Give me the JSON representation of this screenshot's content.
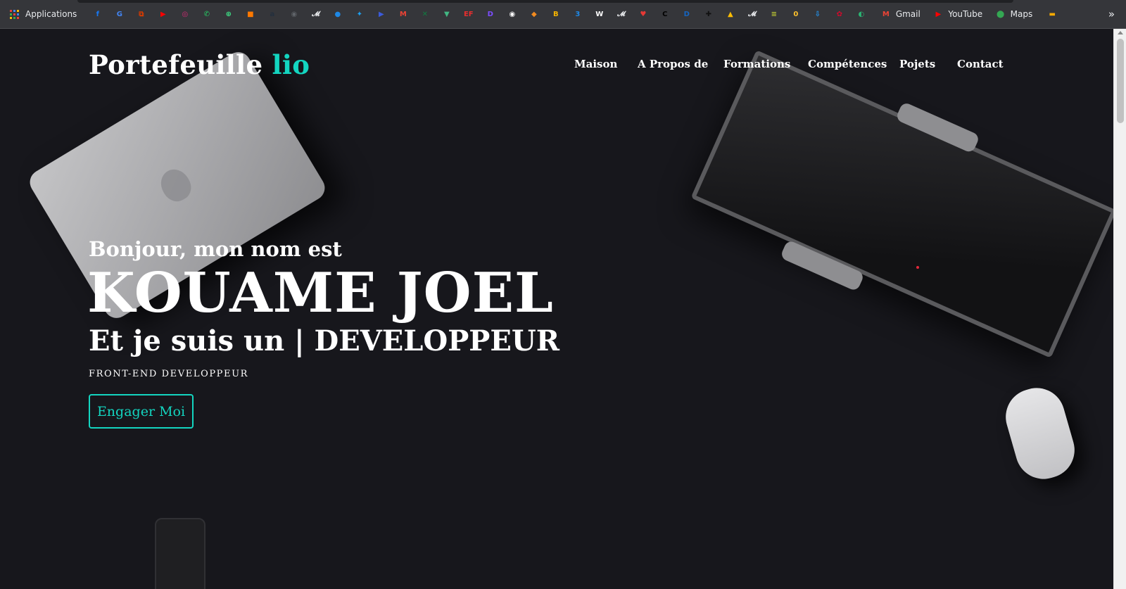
{
  "bookmarks": {
    "apps_label": "Applications",
    "icons": [
      {
        "name": "facebook-icon",
        "glyph": "f",
        "color": "#1877f2"
      },
      {
        "name": "google-translate-icon",
        "glyph": "G",
        "color": "#4285f4"
      },
      {
        "name": "office-icon",
        "glyph": "⧉",
        "color": "#d83b01"
      },
      {
        "name": "youtube-icon",
        "glyph": "▶",
        "color": "#ff0000"
      },
      {
        "name": "instagram-icon",
        "glyph": "◎",
        "color": "#d62976"
      },
      {
        "name": "whatsapp-icon",
        "glyph": "✆",
        "color": "#25d366"
      },
      {
        "name": "android-icon",
        "glyph": "⊕",
        "color": "#3ddc84"
      },
      {
        "name": "orange-icon",
        "glyph": "■",
        "color": "#ff7900"
      },
      {
        "name": "amazon-icon",
        "glyph": "a",
        "color": "#232f3e"
      },
      {
        "name": "globe-icon",
        "glyph": "◉",
        "color": "#5f6368"
      },
      {
        "name": "script-icon",
        "glyph": "𝓜",
        "color": "#e8eaed"
      },
      {
        "name": "cloud-icon",
        "glyph": "●",
        "color": "#1e88e5"
      },
      {
        "name": "twitter-icon",
        "glyph": "✦",
        "color": "#1da1f2"
      },
      {
        "name": "video-icon",
        "glyph": "▶",
        "color": "#3b5bdb"
      },
      {
        "name": "gmail-icon",
        "glyph": "M",
        "color": "#ea4335"
      },
      {
        "name": "excel-icon",
        "glyph": "✕",
        "color": "#107c41"
      },
      {
        "name": "vue-icon",
        "glyph": "▼",
        "color": "#42b883"
      },
      {
        "name": "ef-icon",
        "glyph": "EF",
        "color": "#e62e2e"
      },
      {
        "name": "d-app-icon",
        "glyph": "D",
        "color": "#7c4dff"
      },
      {
        "name": "record-icon",
        "glyph": "◉",
        "color": "#ffffff"
      },
      {
        "name": "diamond-icon",
        "glyph": "◆",
        "color": "#f28b20"
      },
      {
        "name": "b-app-icon",
        "glyph": "B",
        "color": "#f5b400"
      },
      {
        "name": "3d-icon",
        "glyph": "3",
        "color": "#1e88e5"
      },
      {
        "name": "w-app-icon",
        "glyph": "W",
        "color": "#ffffff"
      },
      {
        "name": "script2-icon",
        "glyph": "𝓜",
        "color": "#e8eaed"
      },
      {
        "name": "heart-icon",
        "glyph": "♥",
        "color": "#e53935"
      },
      {
        "name": "c-app-icon",
        "glyph": "C",
        "color": "#000000"
      },
      {
        "name": "dp-icon",
        "glyph": "D",
        "color": "#1565c0"
      },
      {
        "name": "plus-icon",
        "glyph": "✚",
        "color": "#111111"
      },
      {
        "name": "google-drive-icon",
        "glyph": "▲",
        "color": "#fbbc04"
      },
      {
        "name": "script3-icon",
        "glyph": "𝓜",
        "color": "#e8eaed"
      },
      {
        "name": "layers-icon",
        "glyph": "≡",
        "color": "#c0ca33"
      },
      {
        "name": "coin-icon",
        "glyph": "0",
        "color": "#fbc02d"
      },
      {
        "name": "download-icon",
        "glyph": "⇩",
        "color": "#2196f3"
      },
      {
        "name": "huawei-icon",
        "glyph": "✿",
        "color": "#cf0a2c"
      },
      {
        "name": "edge-icon",
        "glyph": "◐",
        "color": "#2ab673"
      }
    ],
    "labeled": [
      {
        "name": "bookmark-gmail",
        "icon_name": "gmail-logo-icon",
        "glyph": "M",
        "color": "#ea4335",
        "label": "Gmail"
      },
      {
        "name": "bookmark-youtube",
        "icon_name": "youtube-logo-icon",
        "glyph": "▶",
        "color": "#ff0000",
        "label": "YouTube"
      },
      {
        "name": "bookmark-maps",
        "icon_name": "maps-pin-icon",
        "glyph": "⬤",
        "color": "#34a853",
        "label": "Maps"
      }
    ],
    "extra_icon": {
      "name": "folder-icon",
      "glyph": "▬",
      "color": "#f9ab00"
    },
    "more": "»"
  },
  "header": {
    "logo_main": "Portefeuille",
    "logo_accent": "lio",
    "nav": [
      "Maison",
      "A Propos de",
      "Formations",
      "Compétences",
      "Pojets",
      "Contact"
    ]
  },
  "hero": {
    "greeting": "Bonjour, mon nom est",
    "name": "KOUAME JOEL",
    "role": "Et je suis un | DEVELOPPEUR",
    "subtitle": "FRONT-END DEVELOPPEUR",
    "cta": "Engager Moi"
  },
  "colors": {
    "accent": "#13d5c0",
    "background": "#17171c",
    "text": "#ffffff"
  }
}
